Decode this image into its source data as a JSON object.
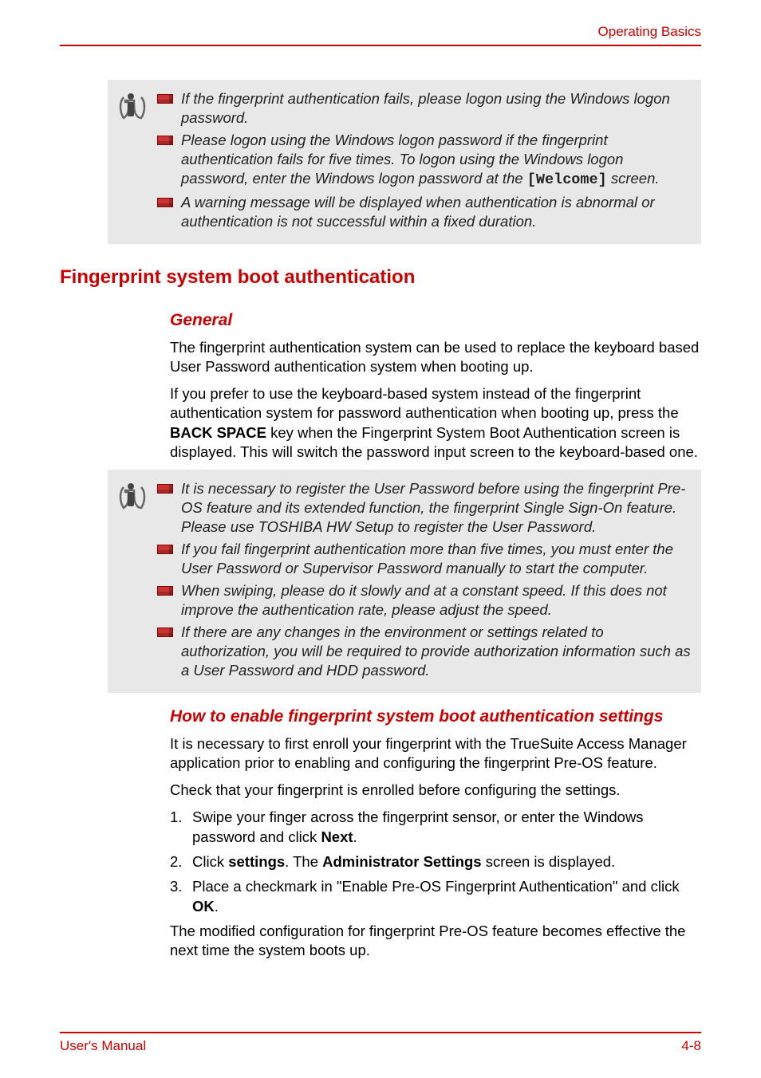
{
  "header": {
    "title": "Operating Basics"
  },
  "note1": {
    "items": [
      {
        "text": "If the fingerprint authentication fails, please logon using the Windows logon password."
      },
      {
        "pre": "Please logon using the Windows logon password if the fingerprint authentication fails for five times. To logon using the Windows logon password, enter the Windows logon password at the ",
        "mono": "[Welcome]",
        "post": " screen."
      },
      {
        "text": "A warning message will be displayed when authentication is abnormal or authentication is not successful within a fixed duration."
      }
    ]
  },
  "section": {
    "h2": "Fingerprint system boot authentication",
    "h3_general": "General",
    "p1": "The fingerprint authentication system can be used to replace the keyboard based User Password authentication system when booting up.",
    "p2_pre": "If you prefer to use the keyboard-based system instead of the fingerprint authentication system for password authentication when booting up, press the ",
    "p2_bold": "BACK SPACE",
    "p2_post": " key when the Fingerprint System Boot Authentication screen is displayed. This will switch the password input screen to the keyboard-based one."
  },
  "note2": {
    "items": [
      "It is necessary to register the User Password before using the fingerprint Pre-OS feature and its extended function, the fingerprint Single Sign-On feature. Please use TOSHIBA HW Setup to register the User Password.",
      "If you fail fingerprint authentication more than five times, you must enter the User Password or Supervisor Password manually to start the computer.",
      "When swiping, please do it slowly and at a constant speed. If this does not improve the authentication rate, please adjust the speed.",
      "If there are any changes in the environment or settings related to authorization, you will be required to provide authorization information such as a User Password and HDD password."
    ]
  },
  "howto": {
    "h3": "How to enable fingerprint system boot authentication settings",
    "p1": "It is necessary to first enroll your fingerprint with the TrueSuite Access Manager application prior to enabling and configuring the fingerprint Pre-OS feature.",
    "p2": "Check that your fingerprint is enrolled before configuring the settings.",
    "steps": [
      {
        "num": "1.",
        "pre": "Swipe your finger across the fingerprint sensor, or enter the Windows password and click ",
        "bold": "Next",
        "post": "."
      },
      {
        "num": "2.",
        "pre": "Click ",
        "bold1": "settings",
        "mid": ". The ",
        "bold2": "Administrator Settings",
        "post": " screen is displayed."
      },
      {
        "num": "3.",
        "pre": "Place a checkmark in \"Enable Pre-OS Fingerprint Authentication\" and click ",
        "bold": "OK",
        "post": "."
      }
    ],
    "p3": "The modified configuration for fingerprint Pre-OS feature becomes effective the next time the system boots up."
  },
  "footer": {
    "left": "User's Manual",
    "right": "4-8"
  }
}
